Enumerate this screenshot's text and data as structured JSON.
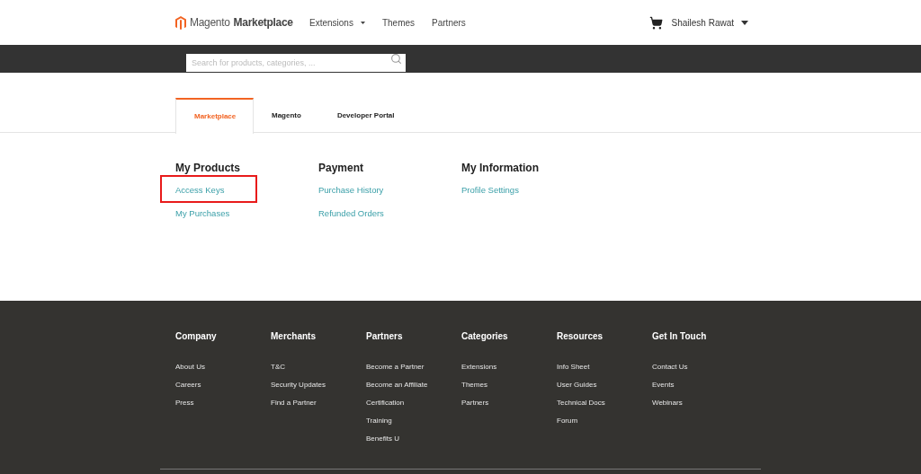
{
  "header": {
    "logo": {
      "brand": "Magento",
      "product": "Marketplace"
    },
    "nav": [
      {
        "label": "Extensions",
        "dropdown": true
      },
      {
        "label": "Themes",
        "dropdown": false
      },
      {
        "label": "Partners",
        "dropdown": false
      }
    ],
    "user": {
      "name": "Shailesh Rawat"
    }
  },
  "search": {
    "placeholder": "Search for products, categories, ..."
  },
  "tabs": [
    {
      "label": "Marketplace",
      "selected": true
    },
    {
      "label": "Magento",
      "selected": false
    },
    {
      "label": "Developer Portal",
      "selected": false
    }
  ],
  "sections": [
    {
      "title": "My Products",
      "links": [
        {
          "label": "Access Keys",
          "highlighted": true
        },
        {
          "label": "My Purchases",
          "highlighted": false
        }
      ]
    },
    {
      "title": "Payment",
      "links": [
        {
          "label": "Purchase History",
          "highlighted": false
        },
        {
          "label": "Refunded Orders",
          "highlighted": false
        }
      ]
    },
    {
      "title": "My Information",
      "links": [
        {
          "label": "Profile Settings",
          "highlighted": false
        }
      ]
    }
  ],
  "footer": {
    "columns": [
      {
        "title": "Company",
        "links": [
          "About Us",
          "Careers",
          "Press"
        ]
      },
      {
        "title": "Merchants",
        "links": [
          "T&C",
          "Security Updates",
          "Find a Partner"
        ]
      },
      {
        "title": "Partners",
        "links": [
          "Become a Partner",
          "Become an Affiliate",
          "Certification",
          "Training",
          "Benefits U"
        ]
      },
      {
        "title": "Categories",
        "links": [
          "Extensions",
          "Themes",
          "Partners"
        ]
      },
      {
        "title": "Resources",
        "links": [
          "Info Sheet",
          "User Guides",
          "Technical Docs",
          "Forum"
        ]
      },
      {
        "title": "Get In Touch",
        "links": [
          "Contact Us",
          "Events",
          "Webinars"
        ]
      }
    ]
  }
}
